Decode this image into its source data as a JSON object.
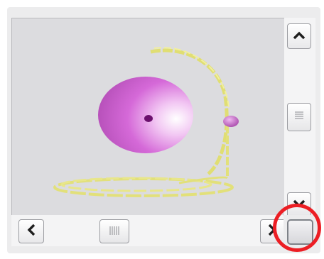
{
  "scene": {
    "description_icon": "3d-scene-icon",
    "sphere_color": "#d569d8",
    "bead_color": "#b657b8",
    "wire_color": "#e2e07a"
  },
  "vscroll": {
    "up_icon": "chevron-up-icon",
    "down_icon": "chevron-down-icon",
    "thumb_grip_icon": "grip-horizontal-icon"
  },
  "hscroll": {
    "left_icon": "chevron-left-icon",
    "right_icon": "chevron-right-icon",
    "thumb_grip_icon": "grip-vertical-icon"
  },
  "corner": {
    "icon": "resize-corner-icon",
    "highlight_color": "#ec1e24"
  }
}
